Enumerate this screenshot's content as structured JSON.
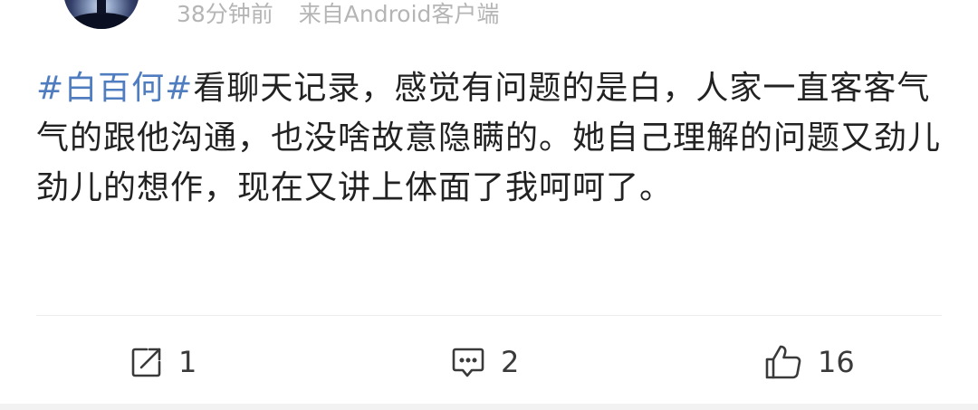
{
  "post": {
    "time": "38分钟前",
    "source": "来自Android客户端",
    "tag": "#白百何#",
    "text": "看聊天记录，感觉有问题的是白，人家一直客客气气的跟他沟通，也没啥故意隐瞒的。她自己理解的问题又劲儿劲儿的想作，现在又讲上体面了我呵呵了。"
  },
  "actions": {
    "repost_count": "1",
    "comment_count": "2",
    "like_count": "16"
  },
  "icons": {
    "repost": "repost-icon",
    "comment": "comment-icon",
    "like": "like-icon"
  },
  "colors": {
    "tag": "#4f7dbf",
    "text": "#222222",
    "meta": "#b5b5b5",
    "action": "#3a3a3a"
  }
}
